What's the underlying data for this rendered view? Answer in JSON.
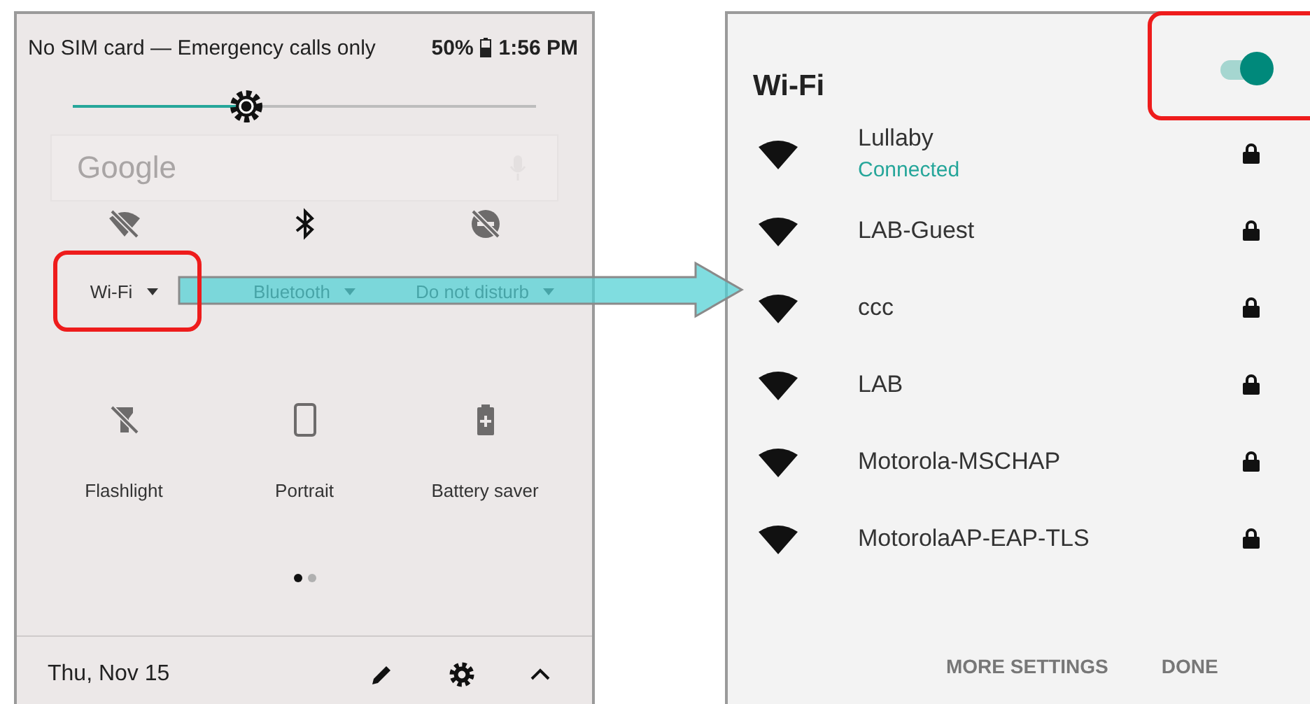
{
  "quick_settings": {
    "status_bar": {
      "carrier": "No SIM card — Emergency calls only",
      "battery": "50%",
      "time": "1:56 PM"
    },
    "brightness": {
      "level": 0.375
    },
    "search": {
      "placeholder": "Google"
    },
    "tiles": [
      {
        "kind": "wifi",
        "label": "Wi-Fi",
        "on": false,
        "dropdown": true
      },
      {
        "kind": "bluetooth",
        "label": "Bluetooth",
        "on": true,
        "dropdown": true
      },
      {
        "kind": "dnd",
        "label": "Do not disturb",
        "on": false,
        "dropdown": true
      },
      {
        "kind": "flashlight",
        "label": "Flashlight",
        "on": false,
        "dropdown": false
      },
      {
        "kind": "portrait",
        "label": "Portrait",
        "on": false,
        "dropdown": false
      },
      {
        "kind": "battery_saver",
        "label": "Battery saver",
        "on": false,
        "dropdown": false
      }
    ],
    "page_dots": [
      {
        "selected": true
      },
      {
        "selected": false
      }
    ],
    "footer": {
      "date": "Thu, Nov 15"
    }
  },
  "wifi_dialog": {
    "title": "Wi-Fi",
    "toggle": {
      "on": true
    },
    "networks": [
      {
        "name": "Lullaby",
        "status": "Connected",
        "locked": true
      },
      {
        "name": "LAB-Guest",
        "locked": true
      },
      {
        "name": "ccc",
        "locked": true
      },
      {
        "name": "LAB",
        "locked": true
      },
      {
        "name": "Motorola-MSCHAP",
        "locked": true
      },
      {
        "name": "MotorolaAP-EAP-TLS",
        "locked": true
      }
    ],
    "buttons": [
      "MORE SETTINGS",
      "DONE"
    ]
  }
}
